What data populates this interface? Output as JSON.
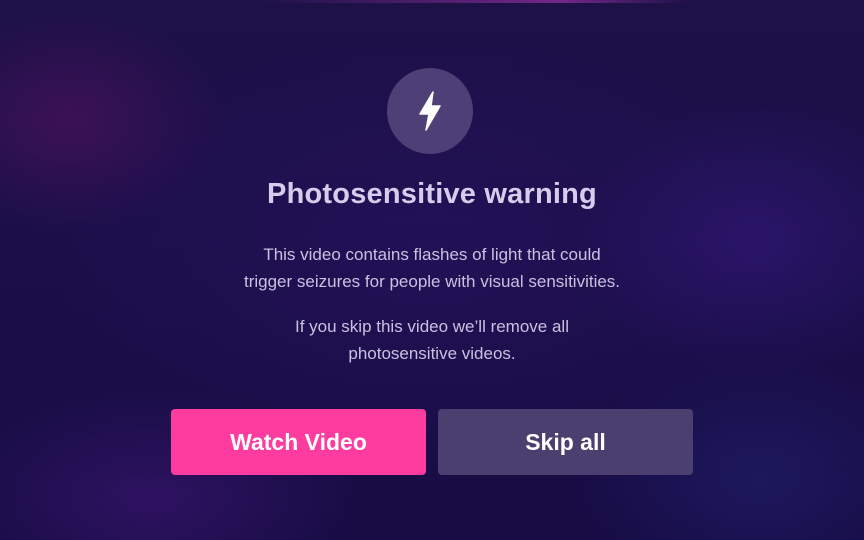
{
  "dialog": {
    "icon": "lightning-bolt-icon",
    "title": "Photosensitive warning",
    "paragraph_1_line_1": "This video contains flashes of light that could",
    "paragraph_1_line_2": "trigger seizures for people with visual sensitivities.",
    "paragraph_2_line_1": "If you skip this video we’ll remove all",
    "paragraph_2_line_2": "photosensitive videos."
  },
  "buttons": {
    "watch_label": "Watch Video",
    "skip_label": "Skip all"
  },
  "colors": {
    "background": "#1b0f4a",
    "icon_circle": "#4e3f76",
    "primary_button": "#fe3b9e",
    "secondary_button": "#4a3f6e",
    "title_text": "#d6cdec",
    "body_text": "#c9c1e0"
  }
}
